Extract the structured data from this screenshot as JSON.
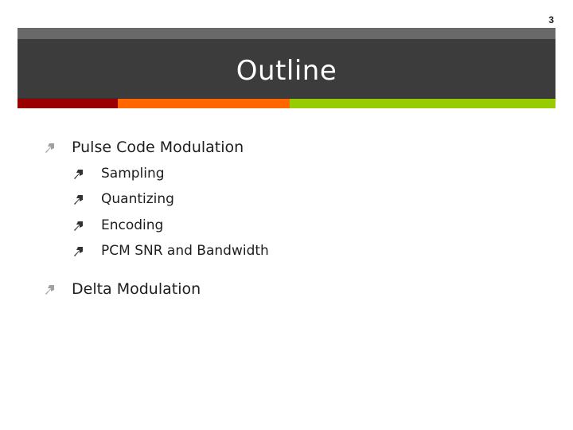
{
  "slide": {
    "number": "3",
    "title": "Outline"
  },
  "theme": {
    "header_top_color": "#696969",
    "header_main_color": "#3c3c3c",
    "stripe_colors": [
      "#990000",
      "#ff6600",
      "#99cc00"
    ],
    "bullet_level1_color": "#a0a0a0",
    "bullet_level2_color": "#333333",
    "text_color": "#1e1e1e"
  },
  "outline": [
    {
      "label": "Pulse Code Modulation",
      "level": 1,
      "icon": "arrow-up-right-icon",
      "children": [
        {
          "label": "Sampling",
          "level": 2,
          "icon": "arrow-up-right-icon"
        },
        {
          "label": "Quantizing",
          "level": 2,
          "icon": "arrow-up-right-icon"
        },
        {
          "label": "Encoding",
          "level": 2,
          "icon": "arrow-up-right-icon"
        },
        {
          "label": "PCM SNR and Bandwidth",
          "level": 2,
          "icon": "arrow-up-right-icon"
        }
      ]
    },
    {
      "label": "Delta Modulation",
      "level": 1,
      "icon": "arrow-up-right-icon",
      "children": []
    }
  ]
}
